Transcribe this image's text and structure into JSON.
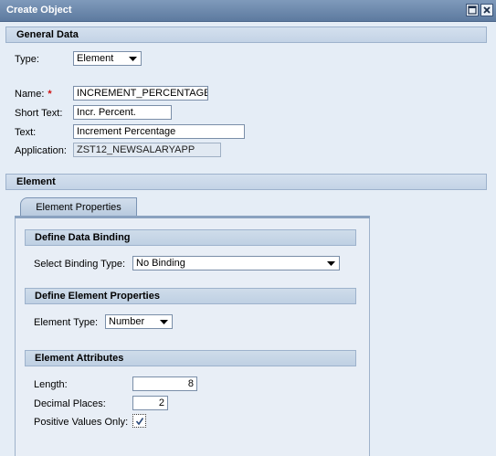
{
  "window": {
    "title": "Create Object"
  },
  "general_data": {
    "header": "General Data",
    "type_label": "Type:",
    "type_value": "Element",
    "name_label": "Name:",
    "name_required": "*",
    "name_value": "INCREMENT_PERCENTAGE",
    "short_text_label": "Short Text:",
    "short_text_value": "Incr. Percent.",
    "text_label": "Text:",
    "text_value": "Increment Percentage",
    "application_label": "Application:",
    "application_value": "ZST12_NEWSALARYAPP"
  },
  "element": {
    "header": "Element",
    "tab_label": "Element Properties",
    "binding": {
      "header": "Define Data Binding",
      "select_label": "Select Binding Type:",
      "select_value": "No Binding"
    },
    "properties": {
      "header": "Define Element Properties",
      "type_label": "Element Type:",
      "type_value": "Number"
    },
    "attributes": {
      "header": "Element Attributes",
      "length_label": "Length:",
      "length_value": "8",
      "decimal_label": "Decimal Places:",
      "decimal_value": "2",
      "positive_label": "Positive Values Only:",
      "positive_checked": true
    }
  }
}
